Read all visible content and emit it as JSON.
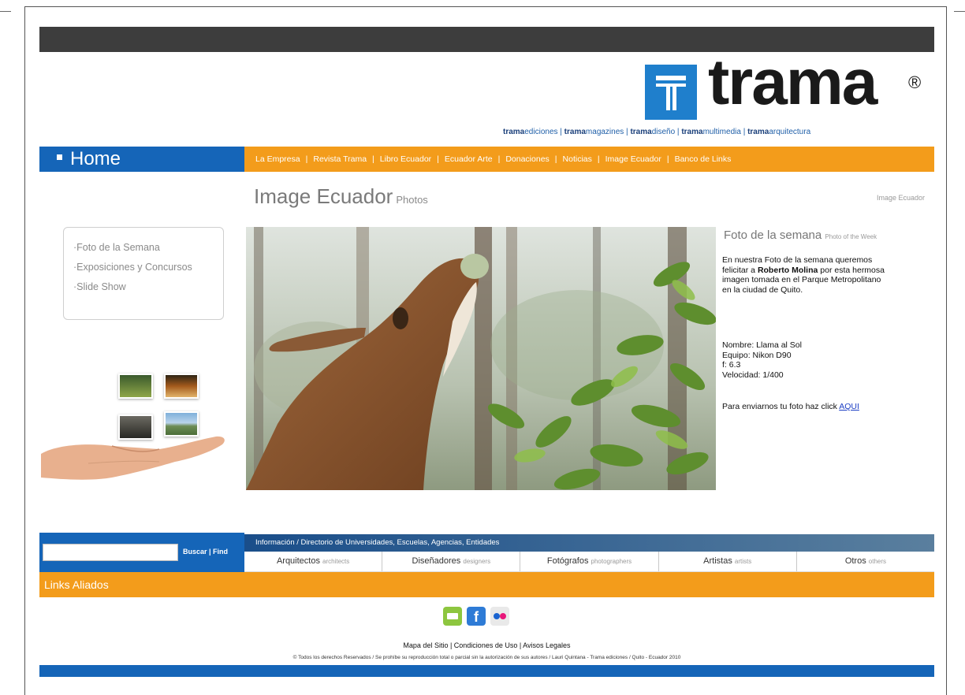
{
  "brand": {
    "name": "trama",
    "registered": "®",
    "sublinks": [
      {
        "bold": "trama",
        "rest": "ediciones"
      },
      {
        "bold": "trama",
        "rest": "magazines"
      },
      {
        "bold": "trama",
        "rest": "diseño"
      },
      {
        "bold": "trama",
        "rest": "multimedia"
      },
      {
        "bold": "trama",
        "rest": "arquitectura"
      }
    ],
    "colors": {
      "blue": "#1565b8",
      "orange": "#f39c1b",
      "dark": "#3d3d3d"
    }
  },
  "nav": {
    "home_label": "Home",
    "items": [
      "La Empresa",
      "Revista Trama",
      "Libro Ecuador",
      "Ecuador Arte",
      "Donaciones",
      "Noticias",
      "Image Ecuador",
      "Banco de Links"
    ]
  },
  "main": {
    "title": "Image Ecuador",
    "subtitle": "Photos",
    "top_right_link": "Image Ecuador"
  },
  "sidebar": {
    "items": [
      "Foto de la Semana",
      "Exposiciones y Concursos",
      "Slide Show"
    ]
  },
  "feature": {
    "title": "Foto de la semana",
    "title_small": "Photo of the Week",
    "body_lines": [
      "En nuestra Foto de la semana queremos",
      "felicitar a Roberto Molina por esta hermosa",
      "imagen tomada en el Parque Metropolitano",
      "en la ciudad de Quito."
    ],
    "photographer": "Roberto Molina",
    "details": [
      "Nombre: Llama al Sol",
      "Equipo: Nikon D90",
      "f: 6.3",
      "Velocidad: 1/400"
    ],
    "cta_text": "Para enviarnos tu foto haz click ",
    "cta_link": "AQUI"
  },
  "bottom": {
    "search_links": "Buscar | Find",
    "directory_label": "Información / Directorio de Universidades, Escuelas, Agencias, Entidades",
    "categories": [
      {
        "es": "Arquitectos",
        "en": "architects"
      },
      {
        "es": "Diseñadores",
        "en": "designers"
      },
      {
        "es": "Fotógrafos",
        "en": "photographers"
      },
      {
        "es": "Artistas",
        "en": "artists"
      },
      {
        "es": "Otros",
        "en": "others"
      }
    ],
    "links_bar": "Links Aliados"
  },
  "social": {
    "icons": [
      "email-icon",
      "facebook-icon",
      "flickr-icon"
    ],
    "facebook_glyph": "f"
  },
  "footer": {
    "links": "Mapa del Sitio | Condiciones de Uso | Avisos Legales",
    "copyright": "© Todos los derechos Reservados / Se prohíbe su reproducción total o parcial sin la autorización de sus autores / Lauri Quintana - Trama ediciones / Quito - Ecuador 2010"
  }
}
